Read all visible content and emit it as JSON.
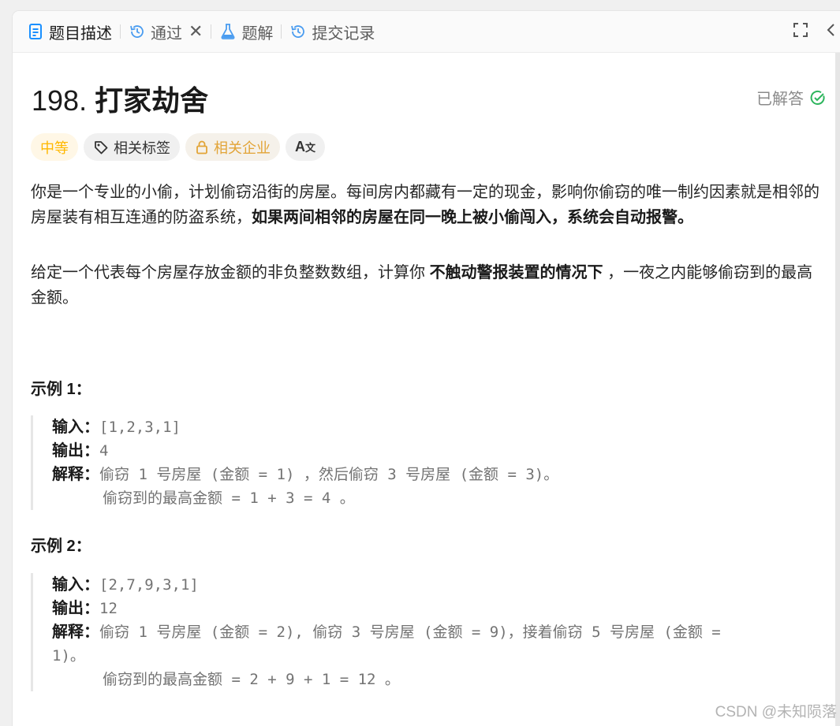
{
  "tabs": {
    "description": "题目描述",
    "passed": "通过",
    "solution": "题解",
    "submissions": "提交记录"
  },
  "problem": {
    "number": "198.",
    "name": "打家劫舍",
    "status": "已解答",
    "tags": {
      "difficulty": "中等",
      "related_tags": "相关标签",
      "related_companies": "相关企业"
    },
    "para1": "你是一个专业的小偷，计划偷窃沿街的房屋。每间房内都藏有一定的现金，影响你偷窃的唯一制约因素就是相邻的房屋装有相互连通的防盗系统，",
    "para1_bold": "如果两间相邻的房屋在同一晚上被小偷闯入，系统会自动报警",
    "para1_end": "。",
    "para2_start": "给定一个代表每个房屋存放金额的非负整数数组，计算你 ",
    "para2_bold": "不触动警报装置的情况下",
    "para2_end": " ，一夜之内能够偷窃到的最高金额。"
  },
  "examples": [
    {
      "heading": "示例 1：",
      "input_label": "输入：",
      "input": "[1,2,3,1]",
      "output_label": "输出：",
      "output": "4",
      "explain_label": "解释：",
      "explain": "偷窃 1 号房屋 (金额 = 1) ，然后偷窃 3 号房屋 (金额 = 3)。",
      "explain2": "偷窃到的最高金额 = 1 + 3 = 4 。"
    },
    {
      "heading": "示例 2：",
      "input_label": "输入：",
      "input": "[2,7,9,3,1]",
      "output_label": "输出：",
      "output": "12",
      "explain_label": "解释：",
      "explain": "偷窃 1 号房屋 (金额 = 2), 偷窃 3 号房屋 (金额 = 9)，接着偷窃 5 号房屋 (金额 =",
      "explain_wrap": "1)。",
      "explain2": "偷窃到的最高金额 = 2 + 9 + 1 = 12 。"
    }
  ],
  "watermark": "CSDN @未知陨落",
  "colors": {
    "accent_blue": "#1a90ff",
    "medium": "#ffb800",
    "solved_green": "#2db55d"
  },
  "icons": [
    "doc-icon",
    "history-icon",
    "close-icon",
    "flask-icon",
    "history-icon",
    "expand-icon",
    "chevron-left-icon",
    "check-circle-icon",
    "tag-icon",
    "lock-icon",
    "translate-icon"
  ]
}
